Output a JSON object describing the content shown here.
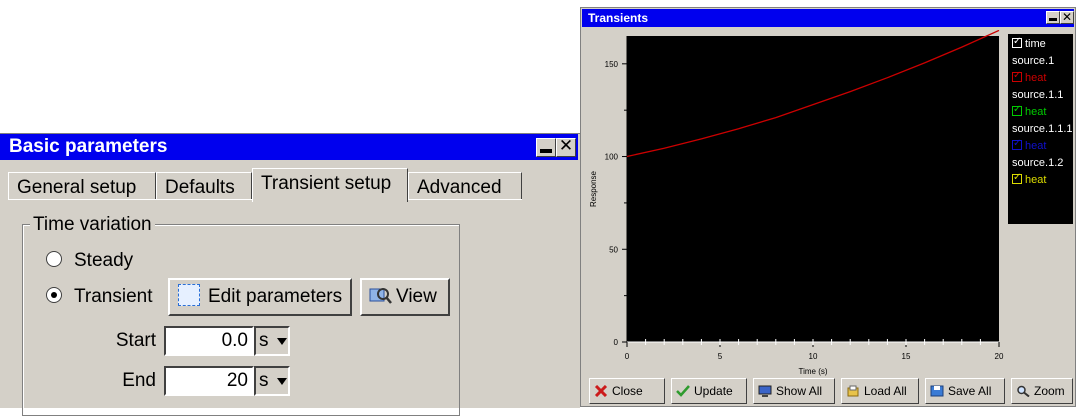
{
  "basic_params": {
    "title": "Basic parameters",
    "tabs": [
      {
        "label": "General setup",
        "active": false
      },
      {
        "label": "Defaults",
        "active": false
      },
      {
        "label": "Transient setup",
        "active": true
      },
      {
        "label": "Advanced",
        "active": false
      }
    ],
    "group_title": "Time variation",
    "radio_steady": {
      "label": "Steady",
      "selected": false
    },
    "radio_transient": {
      "label": "Transient",
      "selected": true
    },
    "edit_params_label": "Edit parameters",
    "view_label": "View",
    "start": {
      "label": "Start",
      "value": "0.0",
      "unit": "s"
    },
    "end": {
      "label": "End",
      "value": "20",
      "unit": "s"
    }
  },
  "transients": {
    "title": "Transients",
    "legend": [
      {
        "kind": "check",
        "label": "time",
        "color": "#ffffff"
      },
      {
        "kind": "text",
        "label": "source.1"
      },
      {
        "kind": "check",
        "label": "heat",
        "color": "#cc0000"
      },
      {
        "kind": "text",
        "label": "source.1.1"
      },
      {
        "kind": "check",
        "label": "heat",
        "color": "#00cc00"
      },
      {
        "kind": "text",
        "label": "source.1.1.1"
      },
      {
        "kind": "check",
        "label": "heat",
        "color": "#1010cc"
      },
      {
        "kind": "text",
        "label": "source.1.2"
      },
      {
        "kind": "check",
        "label": "heat",
        "color": "#dddd00"
      }
    ],
    "buttons": [
      {
        "label": "Close",
        "icon": "close-icon"
      },
      {
        "label": "Update",
        "icon": "check-icon"
      },
      {
        "label": "Show All",
        "icon": "monitor-icon"
      },
      {
        "label": "Load All",
        "icon": "load-icon"
      },
      {
        "label": "Save All",
        "icon": "save-icon"
      },
      {
        "label": "Zoom",
        "icon": "zoom-icon"
      }
    ]
  },
  "chart_data": {
    "type": "line",
    "xlabel": "Time (s)",
    "ylabel": "Response",
    "xlim": [
      0,
      20
    ],
    "ylim": [
      0,
      165
    ],
    "xticks": [
      0,
      5,
      10,
      15,
      20
    ],
    "yticks": [
      0,
      50,
      100,
      150
    ],
    "grid": false,
    "background": "#000000",
    "series": [
      {
        "name": "heat",
        "color": "#cc0000",
        "x": [
          0,
          2,
          4,
          6,
          8,
          10,
          12,
          14,
          16,
          18,
          20
        ],
        "y": [
          100,
          104.5,
          109.5,
          115,
          121,
          128,
          135,
          142.5,
          150.5,
          159,
          168
        ]
      }
    ]
  }
}
